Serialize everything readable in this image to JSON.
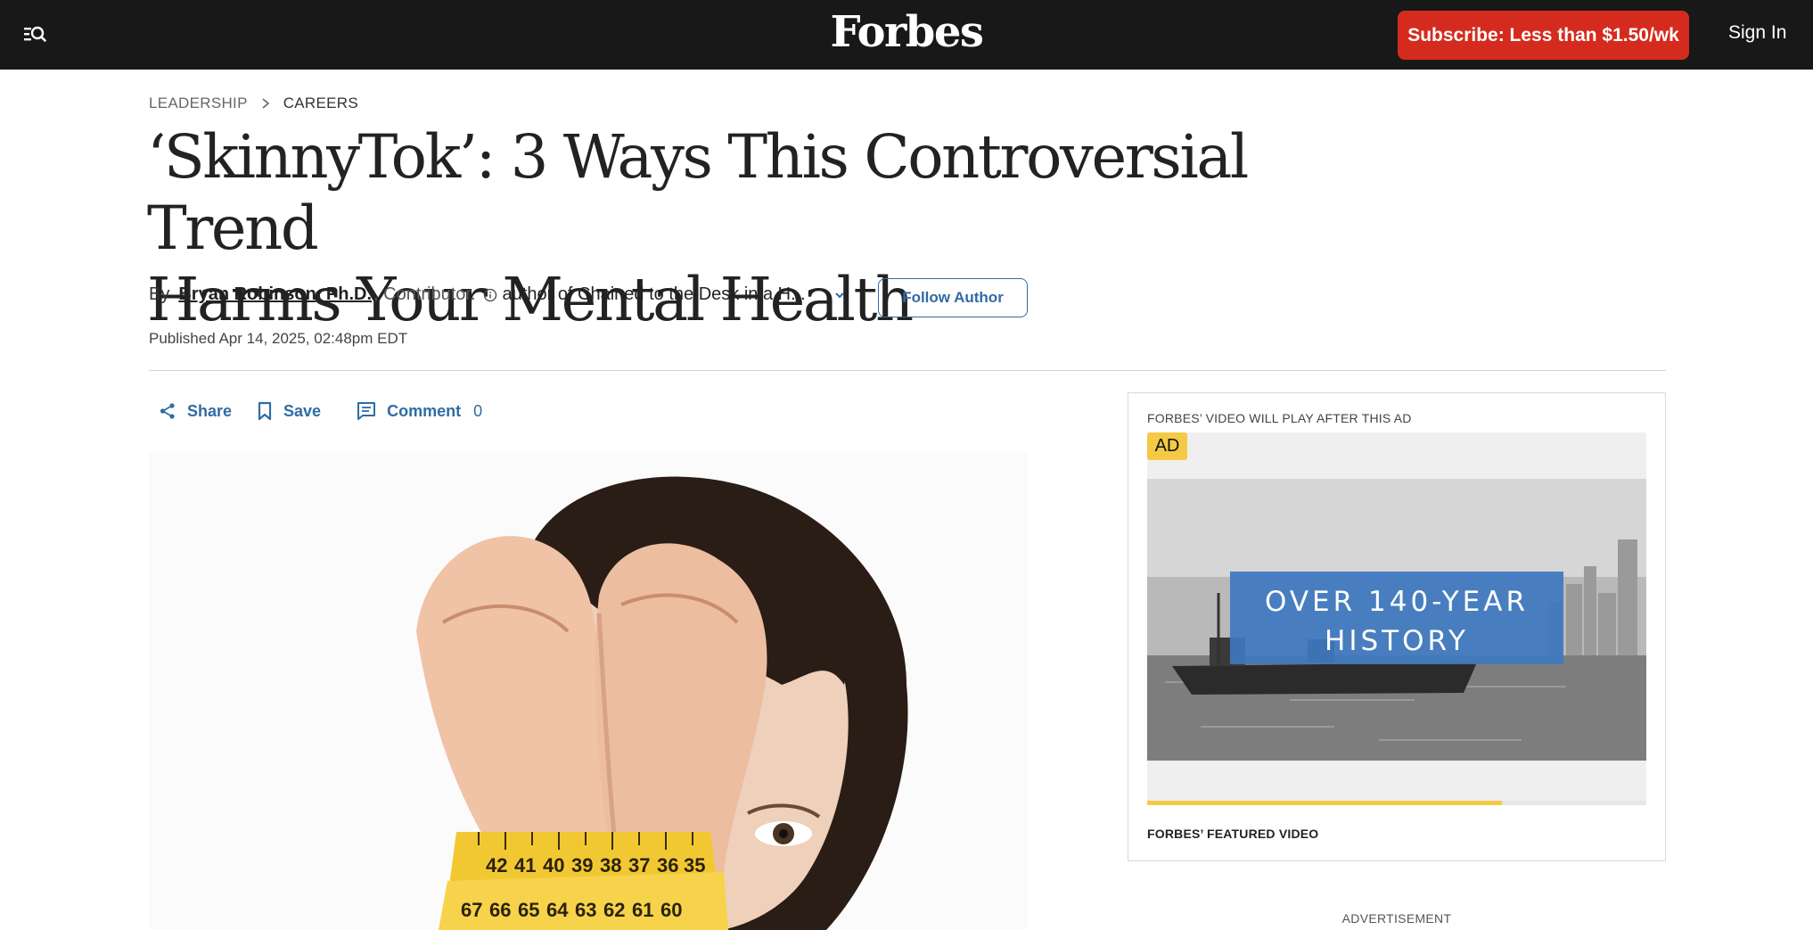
{
  "header": {
    "logo": "Forbes",
    "subscribe_label": "Subscribe: Less than $1.50/wk",
    "signin_label": "Sign In",
    "menu_icon": "menu-search-icon"
  },
  "breadcrumb": {
    "items": [
      "LEADERSHIP",
      "CAREERS"
    ]
  },
  "article": {
    "headline_line1": "‘SkinnyTok’: 3 Ways This Controversial Trend",
    "headline_line2": "Harms Your Mental Health",
    "byline_prefix": "By",
    "author": "Bryan Robinson, Ph.D.",
    "author_role": ", Contributor.",
    "author_desc": "author of Chained to the Desk in a H...",
    "follow_label": "Follow Author",
    "published": "Published Apr 14, 2025, 02:48pm EDT"
  },
  "actions": {
    "share_label": "Share",
    "save_label": "Save",
    "comment_label": "Comment",
    "comment_count": "0"
  },
  "video": {
    "ad_note": "FORBES’ VIDEO WILL PLAY AFTER THIS AD",
    "ad_badge": "AD",
    "overlay_line1": "OVER 140-YEAR",
    "overlay_line2": "HISTORY",
    "caption": "FORBES’ FEATURED VIDEO",
    "progress": 0.71
  },
  "advertisement_label": "ADVERTISEMENT",
  "colors": {
    "topbar": "#181818",
    "subscribe": "#d52b1e",
    "link_blue": "#2f6ca3",
    "ad_yellow": "#f4c945"
  }
}
